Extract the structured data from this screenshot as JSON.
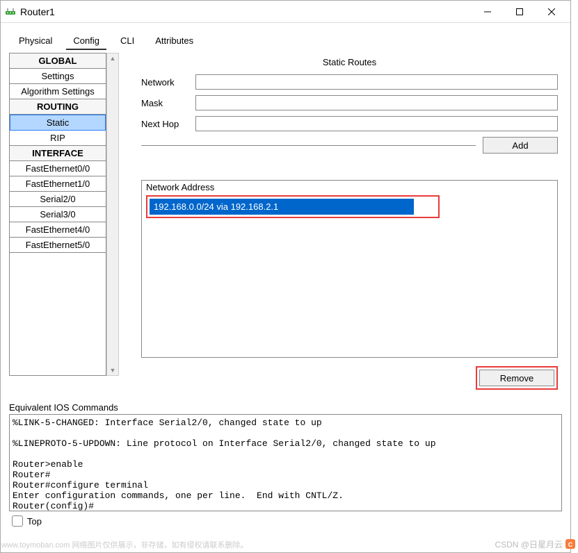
{
  "window": {
    "title": "Router1"
  },
  "tabs": [
    "Physical",
    "Config",
    "CLI",
    "Attributes"
  ],
  "active_tab": "Config",
  "sidebar": {
    "sections": [
      {
        "header": "GLOBAL",
        "items": [
          "Settings",
          "Algorithm Settings"
        ]
      },
      {
        "header": "ROUTING",
        "items": [
          "Static",
          "RIP"
        ]
      },
      {
        "header": "INTERFACE",
        "items": [
          "FastEthernet0/0",
          "FastEthernet1/0",
          "Serial2/0",
          "Serial3/0",
          "FastEthernet4/0",
          "FastEthernet5/0"
        ]
      }
    ],
    "selected": "Static"
  },
  "panel": {
    "title": "Static Routes",
    "fields": {
      "network_label": "Network",
      "network_value": "",
      "mask_label": "Mask",
      "mask_value": "",
      "nexthop_label": "Next Hop",
      "nexthop_value": ""
    },
    "add_button": "Add",
    "list_label": "Network Address",
    "routes": [
      "192.168.0.0/24 via 192.168.2.1"
    ],
    "remove_button": "Remove"
  },
  "ios": {
    "label": "Equivalent IOS Commands",
    "output": "%LINK-5-CHANGED: Interface Serial2/0, changed state to up\n\n%LINEPROTO-5-UPDOWN: Line protocol on Interface Serial2/0, changed state to up\n\nRouter>enable\nRouter#\nRouter#configure terminal\nEnter configuration commands, one per line.  End with CNTL/Z.\nRouter(config)#\nRouter(config)#"
  },
  "bottom": {
    "top_label": "Top"
  },
  "watermark": {
    "left": "www.toymoban.com 网络图片仅供展示，非存储，如有侵权请联系删除。",
    "right": "CSDN @日星月云"
  }
}
